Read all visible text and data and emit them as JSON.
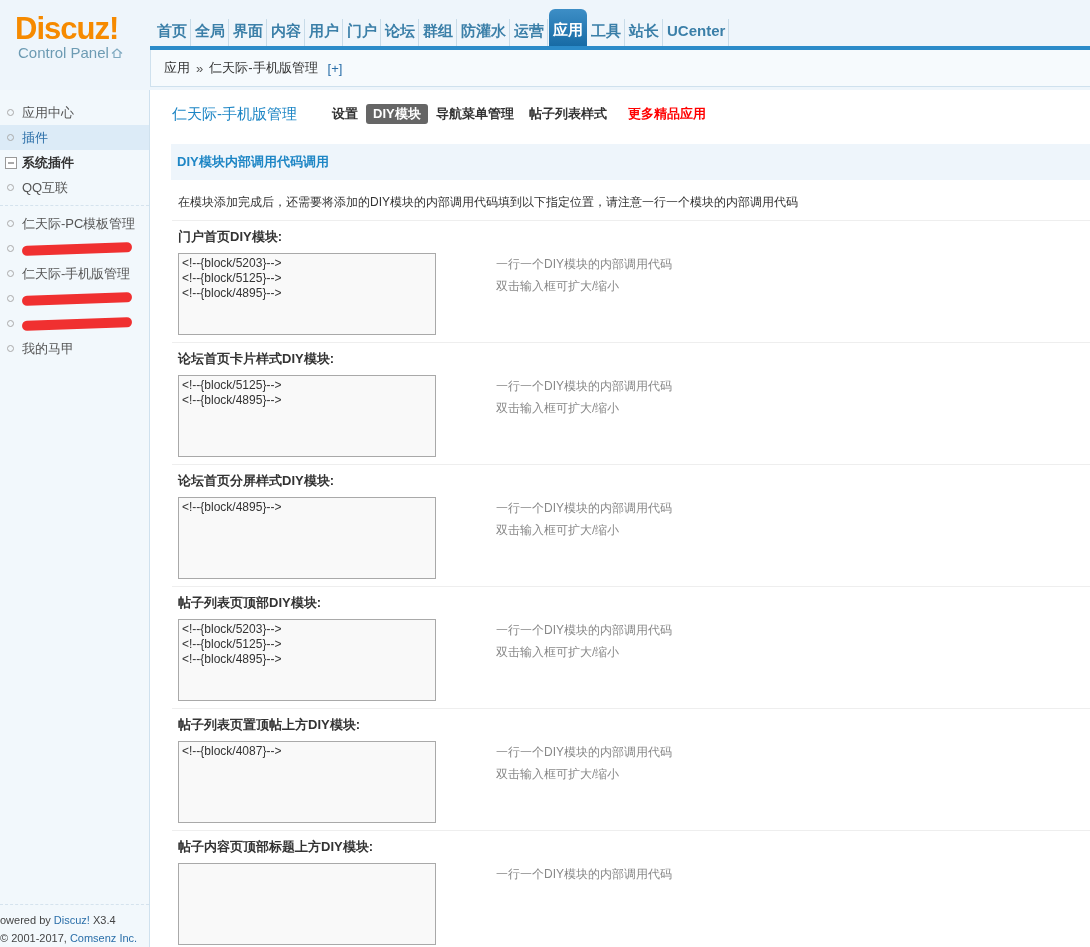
{
  "logo": {
    "title": "Discuz!",
    "subtitle": "Control Panel"
  },
  "nav": [
    {
      "label": "首页",
      "selected": false
    },
    {
      "label": "全局",
      "selected": false
    },
    {
      "label": "界面",
      "selected": false
    },
    {
      "label": "内容",
      "selected": false
    },
    {
      "label": "用户",
      "selected": false
    },
    {
      "label": "门户",
      "selected": false
    },
    {
      "label": "论坛",
      "selected": false
    },
    {
      "label": "群组",
      "selected": false
    },
    {
      "label": "防灌水",
      "selected": false
    },
    {
      "label": "运营",
      "selected": false
    },
    {
      "label": "应用",
      "selected": true
    },
    {
      "label": "工具",
      "selected": false
    },
    {
      "label": "站长",
      "selected": false
    },
    {
      "label": "UCenter",
      "selected": false
    }
  ],
  "breadcrumb": {
    "parent": "应用",
    "separator": "»",
    "current": "仁天际-手机版管理",
    "add": "[+]"
  },
  "sidebar": {
    "items": [
      {
        "kind": "link",
        "label": "应用中心",
        "selected": false
      },
      {
        "kind": "link",
        "label": "插件",
        "selected": true
      },
      {
        "kind": "group",
        "label": "系统插件",
        "expanded": true,
        "children": [
          {
            "label": "QQ互联",
            "selected": false
          }
        ]
      },
      {
        "kind": "divider"
      },
      {
        "kind": "link",
        "label": "仁天际-PC模板管理",
        "selected": false
      },
      {
        "kind": "redacted"
      },
      {
        "kind": "link",
        "label": "仁天际-手机版管理",
        "selected": false
      },
      {
        "kind": "redacted"
      },
      {
        "kind": "redacted"
      },
      {
        "kind": "link",
        "label": "我的马甲",
        "selected": false
      }
    ],
    "footer": [
      {
        "before": "owered by ",
        "link": "Discuz!",
        "after": " X3.4"
      },
      {
        "before": "© 2001-2017, ",
        "link": "Comsenz Inc."
      }
    ]
  },
  "content": {
    "title": "仁天际-手机版管理",
    "tabs": [
      {
        "kind": "tab",
        "label": "设置",
        "selected": false
      },
      {
        "kind": "tab",
        "label": "DIY模块",
        "selected": true
      },
      {
        "kind": "tab",
        "label": "导航菜单管理",
        "selected": false
      },
      {
        "kind": "tab",
        "label": "帖子列表样式",
        "selected": false
      },
      {
        "kind": "promo",
        "label": "更多精品应用"
      }
    ],
    "section_title": "DIY模块内部调用代码调用",
    "description": "在模块添加完成后，还需要将添加的DIY模块的内部调用代码填到以下指定位置，请注意一行一个模块的内部调用代码",
    "fields": [
      {
        "label": "门户首页DIY模块:",
        "value": "<!--{block/5203}-->\n<!--{block/5125}-->\n<!--{block/4895}-->",
        "hints": [
          "一行一个DIY模块的内部调用代码",
          "双击输入框可扩大/缩小"
        ]
      },
      {
        "label": "论坛首页卡片样式DIY模块:",
        "value": "<!--{block/5125}-->\n<!--{block/4895}-->",
        "hints": [
          "一行一个DIY模块的内部调用代码",
          "双击输入框可扩大/缩小"
        ]
      },
      {
        "label": "论坛首页分屏样式DIY模块:",
        "value": "<!--{block/4895}-->",
        "hints": [
          "一行一个DIY模块的内部调用代码",
          "双击输入框可扩大/缩小"
        ]
      },
      {
        "label": "帖子列表页顶部DIY模块:",
        "value": "<!--{block/5203}-->\n<!--{block/5125}-->\n<!--{block/4895}-->",
        "hints": [
          "一行一个DIY模块的内部调用代码",
          "双击输入框可扩大/缩小"
        ]
      },
      {
        "label": "帖子列表页置顶帖上方DIY模块:",
        "value": "<!--{block/4087}-->",
        "hints": [
          "一行一个DIY模块的内部调用代码",
          "双击输入框可扩大/缩小"
        ]
      },
      {
        "label": "帖子内容页顶部标题上方DIY模块:",
        "hints": [
          "一行一个DIY模块的内部调用代码"
        ]
      }
    ]
  }
}
